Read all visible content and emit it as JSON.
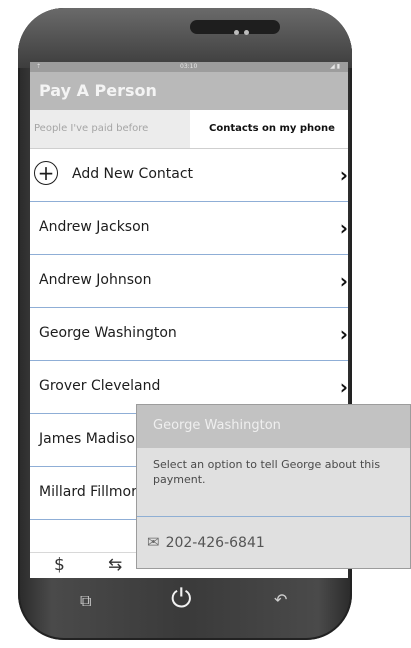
{
  "statusbar": {
    "left": "⇡",
    "center": "03:10",
    "right": "◢ ▮"
  },
  "app": {
    "title": "Pay A Person"
  },
  "tabs": [
    {
      "label": "People I've paid before"
    },
    {
      "label": "Contacts on my phone"
    }
  ],
  "list": {
    "add_label": "Add New Contact",
    "contacts": [
      {
        "label": "Andrew Jackson"
      },
      {
        "label": "Andrew Johnson"
      },
      {
        "label": "George Washington"
      },
      {
        "label": "Grover Cleveland"
      },
      {
        "label": "James Madison"
      },
      {
        "label": "Millard Fillmore"
      }
    ],
    "chevron": "›"
  },
  "bottom_tabs": {
    "pay": "$",
    "transfer": "⇆"
  },
  "navbar": {
    "recent": "⧉",
    "power": "⏻",
    "back": "↶"
  },
  "popup": {
    "title": "George Washington",
    "message": "Select an option to tell George about this payment.",
    "phone_number": "202-426-6841",
    "envelope": "✉"
  }
}
